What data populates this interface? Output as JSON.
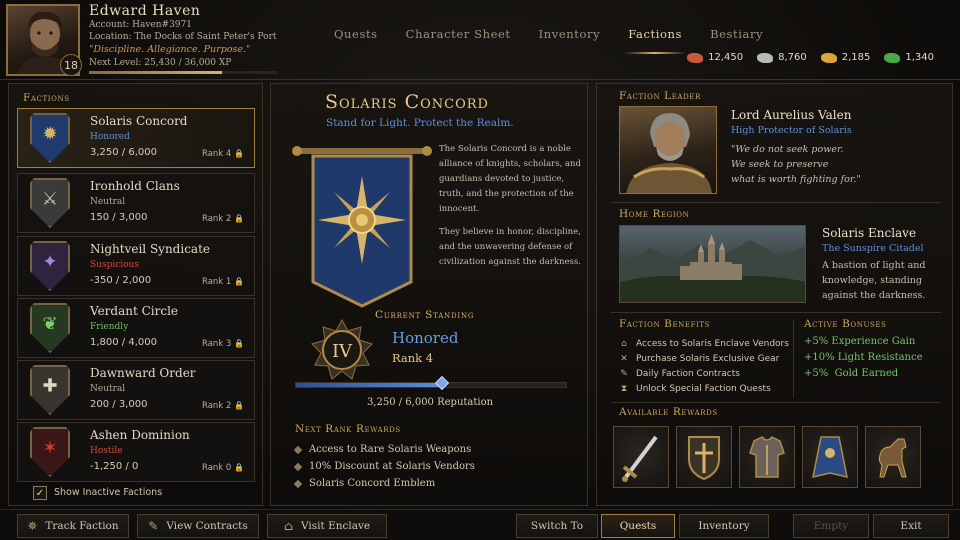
{
  "player": {
    "name": "Edward Haven",
    "account": "Account: Haven#3971",
    "location": "Location: The Docks of Saint Peter's Port",
    "motto": "\"Discipline. Allegiance. Purpose.\"",
    "next_level": "Next Level: 25,430 / 36,000 XP",
    "xp_fraction": 0.706,
    "level": "18"
  },
  "tabs": [
    {
      "label": "Quests",
      "active": false
    },
    {
      "label": "Character Sheet",
      "active": false
    },
    {
      "label": "Inventory",
      "active": false
    },
    {
      "label": "Factions",
      "active": true
    },
    {
      "label": "Bestiary",
      "active": false
    }
  ],
  "currencies": [
    {
      "icon": "copper-ore-icon",
      "value": "12,450",
      "color": "#c65a3a"
    },
    {
      "icon": "silver-ore-icon",
      "value": "8,760",
      "color": "#b8b8b8"
    },
    {
      "icon": "gold-ore-icon",
      "value": "2,185",
      "color": "#d8a63a"
    },
    {
      "icon": "emerald-icon",
      "value": "1,340",
      "color": "#4aa84a"
    }
  ],
  "factions_panel": {
    "title": "Factions",
    "show_inactive_label": "Show Inactive Factions",
    "show_inactive_checked": true,
    "check_mark": "✓",
    "items": [
      {
        "name": "Solaris Concord",
        "status": "Honored",
        "status_color": "#5f8fd8",
        "rep": "3,250 / 6,000",
        "rank": "Rank 4",
        "icon": "sun-icon",
        "glyph": "✹",
        "shield_color": "#1f3b6e",
        "glyph_color": "#d8b46a",
        "selected": true
      },
      {
        "name": "Ironhold Clans",
        "status": "Neutral",
        "status_color": "#b9ae99",
        "rep": "150 / 3,000",
        "rank": "Rank 2",
        "icon": "crossed-axes-icon",
        "glyph": "⚔",
        "shield_color": "#3a3a38",
        "glyph_color": "#c9c4b8",
        "selected": false
      },
      {
        "name": "Nightveil Syndicate",
        "status": "Suspicious",
        "status_color": "#d2483a",
        "rep": "-350 / 2,000",
        "rank": "Rank 1",
        "icon": "dagger-star-icon",
        "glyph": "✦",
        "shield_color": "#2e2440",
        "glyph_color": "#a889d8",
        "selected": false
      },
      {
        "name": "Verdant Circle",
        "status": "Friendly",
        "status_color": "#6cbf5c",
        "rep": "1,800 / 4,000",
        "rank": "Rank 3",
        "icon": "leaf-icon",
        "glyph": "❦",
        "shield_color": "#263822",
        "glyph_color": "#7fd06a",
        "selected": false
      },
      {
        "name": "Dawnward Order",
        "status": "Neutral",
        "status_color": "#b9ae99",
        "rep": "200 / 3,000",
        "rank": "Rank 2",
        "icon": "holy-cross-icon",
        "glyph": "✚",
        "shield_color": "#3a3430",
        "glyph_color": "#e0d6c4",
        "selected": false
      },
      {
        "name": "Ashen Dominion",
        "status": "Hostile",
        "status_color": "#d2483a",
        "rep": "-1,250 / 0",
        "rank": "Rank 0",
        "icon": "flame-icon",
        "glyph": "✶",
        "shield_color": "#3a1616",
        "glyph_color": "#d83a2a",
        "selected": false
      }
    ],
    "lock_glyph": "🔒"
  },
  "faction": {
    "name": "Solaris Concord",
    "tagline": "Stand for Light. Protect the Realm.",
    "description_1": "The Solaris Concord is a noble alliance of knights, scholars, and guardians devoted to justice, truth, and the protection of the innocent.",
    "description_2": "They believe in honor, discipline, and the unwavering defense of civilization against the darkness.",
    "standing_label": "Current Standing",
    "standing": "Honored",
    "rank": "Rank 4",
    "rank_numeral": "IV",
    "reputation_text": "3,250 / 6,000 Reputation",
    "reputation_fraction": 0.542,
    "next_rank_title": "Next Rank Rewards",
    "next_rank_rewards": [
      "Access to Rare Solaris Weapons",
      "10% Discount at Solaris Vendors",
      "Solaris Concord Emblem"
    ]
  },
  "leader": {
    "section": "Faction Leader",
    "name": "Lord Aurelius Valen",
    "title": "High Protector of Solaris",
    "quote_1": "\"We do not seek power.",
    "quote_2": "We seek to preserve",
    "quote_3": "what is worth fighting for.\""
  },
  "home": {
    "section": "Home Region",
    "name": "Solaris Enclave",
    "sub": "The Sunspire Citadel",
    "desc": "A bastion of light and knowledge, standing against the darkness."
  },
  "benefits": {
    "section": "Faction Benefits",
    "items": [
      {
        "icon": "shop-icon",
        "glyph": "⌂",
        "text": "Access to Solaris Enclave Vendors"
      },
      {
        "icon": "crossed-swords-icon",
        "glyph": "✕",
        "text": "Purchase Solaris Exclusive Gear"
      },
      {
        "icon": "scroll-icon",
        "glyph": "✎",
        "text": "Daily Faction Contracts"
      },
      {
        "icon": "hourglass-icon",
        "glyph": "⧗",
        "text": "Unlock Special Faction Quests"
      }
    ]
  },
  "bonuses": {
    "section": "Active Bonuses",
    "items": [
      "+5% Experience Gain",
      "+10% Light Resistance",
      "+5%  Gold Earned"
    ]
  },
  "rewards": {
    "section": "Available Rewards",
    "items": [
      {
        "icon": "sword-icon"
      },
      {
        "icon": "shield-icon"
      },
      {
        "icon": "armor-icon"
      },
      {
        "icon": "cloak-icon"
      },
      {
        "icon": "warhorse-icon"
      }
    ]
  },
  "bottom_bar": {
    "track": "Track Faction",
    "contracts": "View Contracts",
    "visit": "Visit Enclave",
    "switch_to": "Switch To",
    "quests": "Quests",
    "inventory": "Inventory",
    "empty": "Empty",
    "exit": "Exit"
  }
}
